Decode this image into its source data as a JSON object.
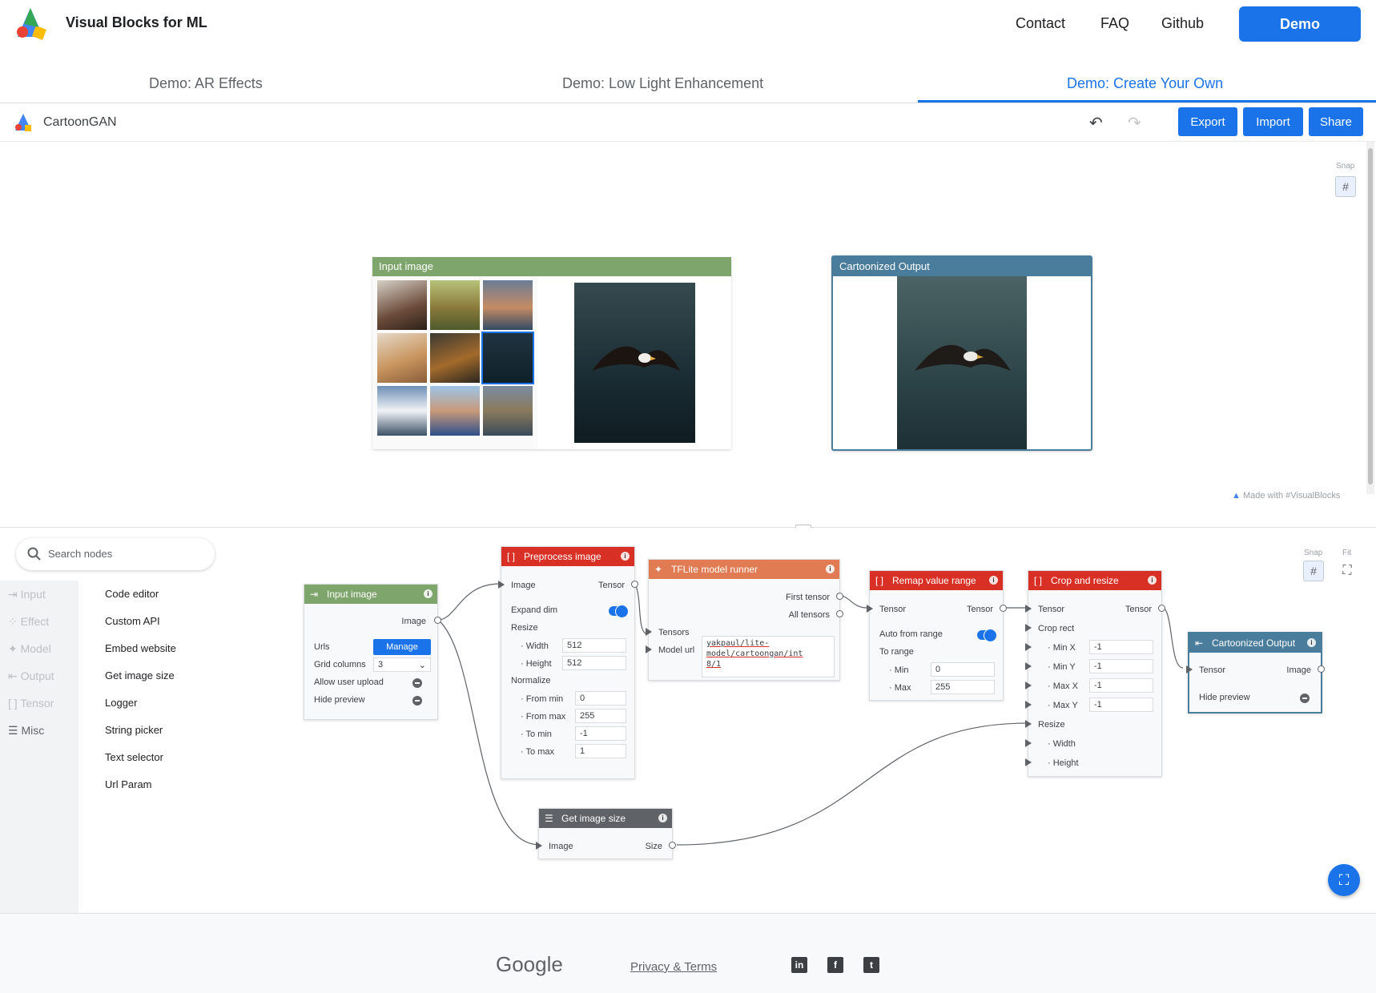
{
  "nav": {
    "brand": "Visual Blocks for ML",
    "links": [
      "Contact",
      "FAQ",
      "Github"
    ],
    "demo": "Demo"
  },
  "tabs": [
    "Demo: AR Effects",
    "Demo: Low Light Enhancement",
    "Demo: Create Your Own"
  ],
  "toolbar": {
    "project": "CartoonGAN",
    "export": "Export",
    "import": "Import",
    "share": "Share"
  },
  "preview": {
    "input_title": "Input image",
    "output_title": "Cartoonized Output",
    "snap": "Snap",
    "made_with": "Made with #VisualBlocks"
  },
  "sidebar": {
    "search_placeholder": "Search nodes",
    "categories": [
      "Input",
      "Effect",
      "Model",
      "Output",
      "Tensor",
      "Misc"
    ],
    "items": [
      "Code editor",
      "Custom API",
      "Embed website",
      "Get image size",
      "Logger",
      "String picker",
      "Text selector",
      "Url Param"
    ]
  },
  "graph": {
    "snap": "Snap",
    "fit": "Fit",
    "input_node": {
      "title": "Input image",
      "out": "Image",
      "urls": "Urls",
      "manage": "Manage",
      "grid_columns": "Grid columns",
      "grid_value": "3",
      "allow_upload": "Allow user upload",
      "hide_preview": "Hide preview"
    },
    "preprocess": {
      "title": "Preprocess image",
      "in": "Image",
      "out": "Tensor",
      "expand_dim": "Expand dim",
      "resize": "Resize",
      "width": "Width",
      "width_v": "512",
      "height": "Height",
      "height_v": "512",
      "normalize": "Normalize",
      "from_min": "From min",
      "from_min_v": "0",
      "from_max": "From max",
      "from_max_v": "255",
      "to_min": "To min",
      "to_min_v": "-1",
      "to_max": "To max",
      "to_max_v": "1"
    },
    "tflite": {
      "title": "TFLite model runner",
      "first": "First tensor",
      "all": "All tensors",
      "tensors": "Tensors",
      "model_url": "Model url",
      "url_lines": [
        "yakpaul/lite-",
        "model/cartoongan/int",
        "8/1"
      ]
    },
    "remap": {
      "title": "Remap value range",
      "in": "Tensor",
      "out": "Tensor",
      "auto": "Auto from range",
      "to_range": "To range",
      "min": "Min",
      "min_v": "0",
      "max": "Max",
      "max_v": "255"
    },
    "crop": {
      "title": "Crop and resize",
      "in": "Tensor",
      "out": "Tensor",
      "crop_rect": "Crop rect",
      "minx": "Min X",
      "miny": "Min Y",
      "maxx": "Max X",
      "maxy": "Max Y",
      "val": "-1",
      "resize": "Resize",
      "width": "Width",
      "height": "Height"
    },
    "output_node": {
      "title": "Cartoonized Output",
      "in": "Tensor",
      "out": "Image",
      "hide_preview": "Hide preview"
    },
    "size_node": {
      "title": "Get image size",
      "in": "Image",
      "out": "Size"
    }
  },
  "footer": {
    "brand": "Google",
    "privacy": "Privacy & Terms"
  }
}
